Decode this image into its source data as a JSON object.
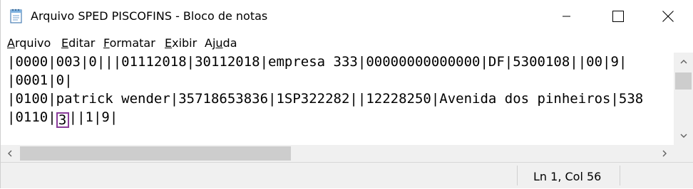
{
  "window": {
    "title": "Arquivo SPED PISCOFINS - Bloco de notas"
  },
  "titlebar_buttons": {
    "minimize_icon": "minimize-icon",
    "maximize_icon": "maximize-icon",
    "close_icon": "close-icon"
  },
  "menu": {
    "items": [
      {
        "mnemonic": "A",
        "rest": "rquivo"
      },
      {
        "mnemonic": "E",
        "rest": "ditar"
      },
      {
        "mnemonic": "F",
        "rest": "ormatar"
      },
      {
        "mnemonic": "E",
        "rest": "xibir"
      },
      {
        "pre": "Aj",
        "mnemonic": "u",
        "rest": "da"
      }
    ]
  },
  "editor": {
    "lines": [
      "|0000|003|0|||01112018|30112018|empresa 333|00000000000000|DF|5300108||00|9|",
      "|0001|0|",
      "|0100|patrick wender|35718653836|1SP322282||12228250|Avenida dos pinheiros|538",
      {
        "before": "|0110|",
        "selected": "3",
        "after": "||1|9|"
      }
    ]
  },
  "statusbar": {
    "position": "Ln 1, Col 56"
  },
  "colors": {
    "selection_border": "#8a3c9a",
    "scrollbar_track": "#f0f0f0",
    "scrollbar_thumb": "#cdcdcd"
  }
}
